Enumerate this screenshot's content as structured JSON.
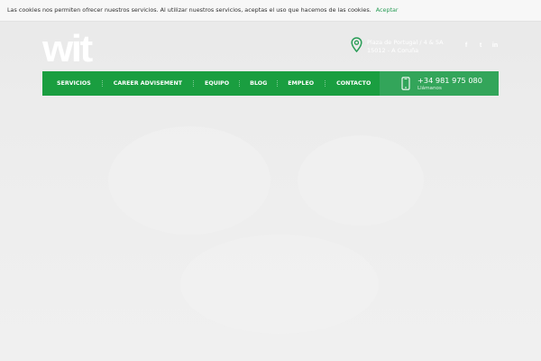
{
  "cookie_bar": {
    "message": "Las cookies nos permiten ofrecer nuestros servicios. Al utilizar nuestros servicios, aceptas el uso que hacemos de las cookies.",
    "accept_label": "Aceptar"
  },
  "header": {
    "logo_text": "wit",
    "address": {
      "line1": "Plaza de Portugal / 4 & 5A",
      "line2": "15012 - A Coruña",
      "icon": "map-pin-icon"
    },
    "social": [
      {
        "name": "facebook-icon",
        "glyph": "f"
      },
      {
        "name": "twitter-icon",
        "glyph": "t"
      },
      {
        "name": "linkedin-icon",
        "glyph": "in"
      }
    ]
  },
  "nav": {
    "items": [
      {
        "label": "SERVICIOS"
      },
      {
        "label": "CAREER ADVISEMENT"
      },
      {
        "label": "EQUIPO"
      },
      {
        "label": "BLOG"
      },
      {
        "label": "EMPLEO"
      },
      {
        "label": "CONTACTO"
      }
    ]
  },
  "contact": {
    "phone": "+34 981 975 080",
    "phone_caption": "Llámanos",
    "icon": "phone-icon"
  },
  "colors": {
    "nav_green": "#1a9e40",
    "phone_green": "#33a55a",
    "pin_green": "#2a9d57",
    "accept_link": "#2a9d57"
  }
}
